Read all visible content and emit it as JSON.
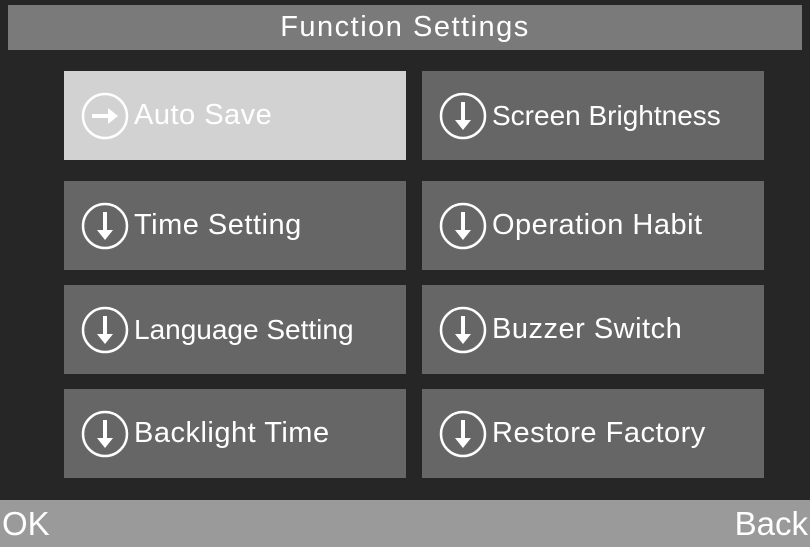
{
  "title": "Function Settings",
  "menu": {
    "items": [
      {
        "label": "Auto Save",
        "icon": "arrow-right-circle-icon",
        "selected": true
      },
      {
        "label": "Screen Brightness",
        "icon": "arrow-down-circle-icon",
        "selected": false
      },
      {
        "label": "Time Setting",
        "icon": "arrow-down-circle-icon",
        "selected": false
      },
      {
        "label": "Operation Habit",
        "icon": "arrow-down-circle-icon",
        "selected": false
      },
      {
        "label": "Language Setting",
        "icon": "arrow-down-circle-icon",
        "selected": false
      },
      {
        "label": "Buzzer Switch",
        "icon": "arrow-down-circle-icon",
        "selected": false
      },
      {
        "label": "Backlight Time",
        "icon": "arrow-down-circle-icon",
        "selected": false
      },
      {
        "label": "Restore Factory",
        "icon": "arrow-down-circle-icon",
        "selected": false
      }
    ]
  },
  "softkeys": {
    "left": "OK",
    "right": "Back"
  },
  "colors": {
    "background": "#262626",
    "title_bar": "#7a7a7a",
    "tile": "#666666",
    "tile_selected": "#d2d2d2",
    "bottom_bar": "#9a9a9a",
    "text": "#ffffff"
  }
}
